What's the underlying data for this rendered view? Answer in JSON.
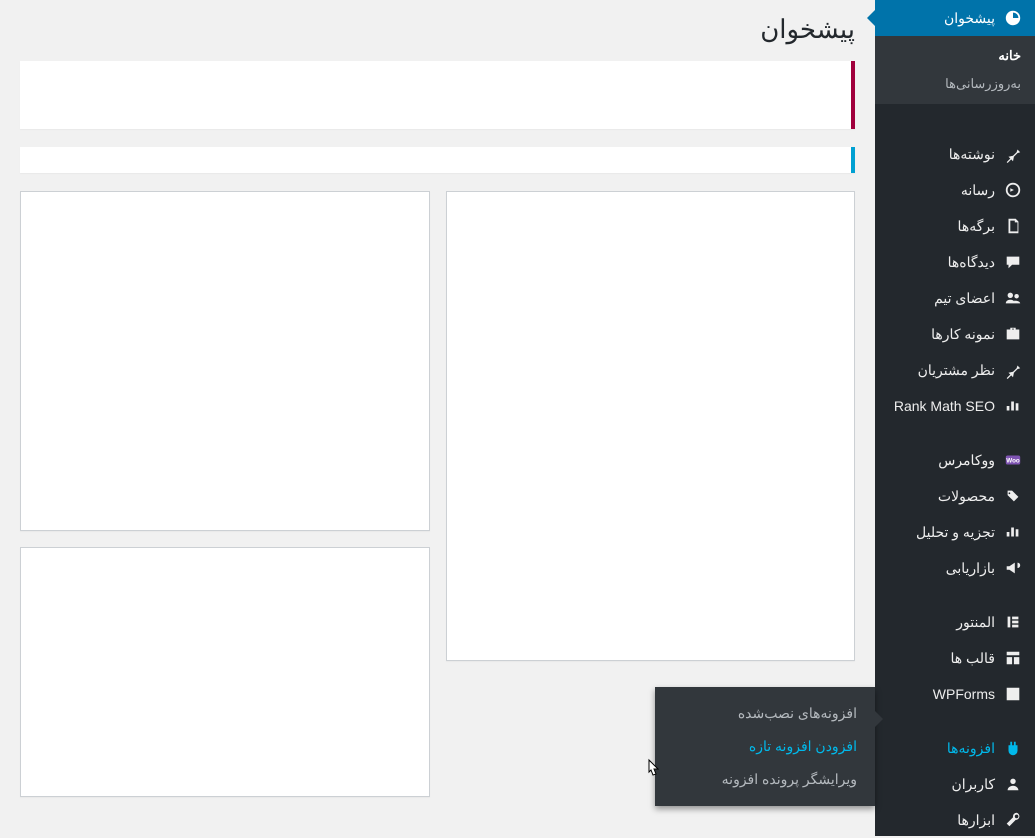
{
  "page": {
    "title": "پیشخوان"
  },
  "sidebar": {
    "dashboard": {
      "label": "پیشخوان"
    },
    "dashboard_sub": {
      "home": "خانه",
      "updates": "به‌روزرسانی‌ها"
    },
    "posts": "نوشته‌ها",
    "media": "رسانه",
    "pages": "برگه‌ها",
    "comments": "دیدگاه‌ها",
    "team": "اعضای تیم",
    "portfolio": "نمونه کارها",
    "testimonials": "نظر مشتریان",
    "rankmath": "Rank Math SEO",
    "woocommerce": "ووکامرس",
    "products": "محصولات",
    "analytics": "تجزیه و تحلیل",
    "marketing": "بازاریابی",
    "elementor": "المنتور",
    "templates": "قالب ها",
    "wpforms": "WPForms",
    "plugins": "افزونه‌ها",
    "users": "کاربران",
    "tools": "ابزارها"
  },
  "flyout": {
    "installed": "افزونه‌های نصب‌شده",
    "addnew": "افزودن افزونه تازه",
    "editor": "ویرایشگر پرونده افزونه"
  }
}
